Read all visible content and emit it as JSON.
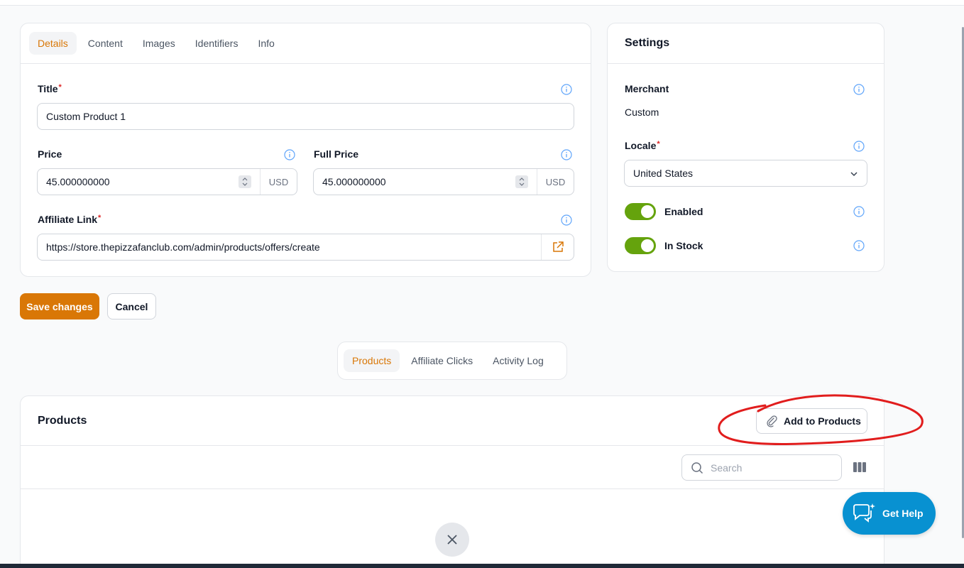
{
  "details": {
    "tabs": [
      "Details",
      "Content",
      "Images",
      "Identifiers",
      "Info"
    ],
    "active_tab": "Details",
    "title_label": "Title",
    "title_value": "Custom Product 1",
    "price_label": "Price",
    "price_value": "45.000000000",
    "price_currency": "USD",
    "full_price_label": "Full Price",
    "full_price_value": "45.000000000",
    "full_price_currency": "USD",
    "affiliate_label": "Affiliate Link",
    "affiliate_value": "https://store.thepizzafanclub.com/admin/products/offers/create",
    "required_mark": "*"
  },
  "settings": {
    "heading": "Settings",
    "merchant_label": "Merchant",
    "merchant_value": "Custom",
    "locale_label": "Locale",
    "locale_value": "United States",
    "enabled_label": "Enabled",
    "enabled_on": true,
    "in_stock_label": "In Stock",
    "in_stock_on": true,
    "required_mark": "*"
  },
  "actions": {
    "save_label": "Save changes",
    "cancel_label": "Cancel"
  },
  "relation_tabs": {
    "items": [
      "Products",
      "Affiliate Clicks",
      "Activity Log"
    ],
    "active": "Products"
  },
  "products": {
    "heading": "Products",
    "add_label": "Add to Products",
    "search_placeholder": "Search"
  },
  "help": {
    "label": "Get Help"
  },
  "colors": {
    "accent": "#d97706",
    "toggle_on": "#65a30d",
    "help": "#0891d1",
    "annotation": "#e11d1d"
  }
}
